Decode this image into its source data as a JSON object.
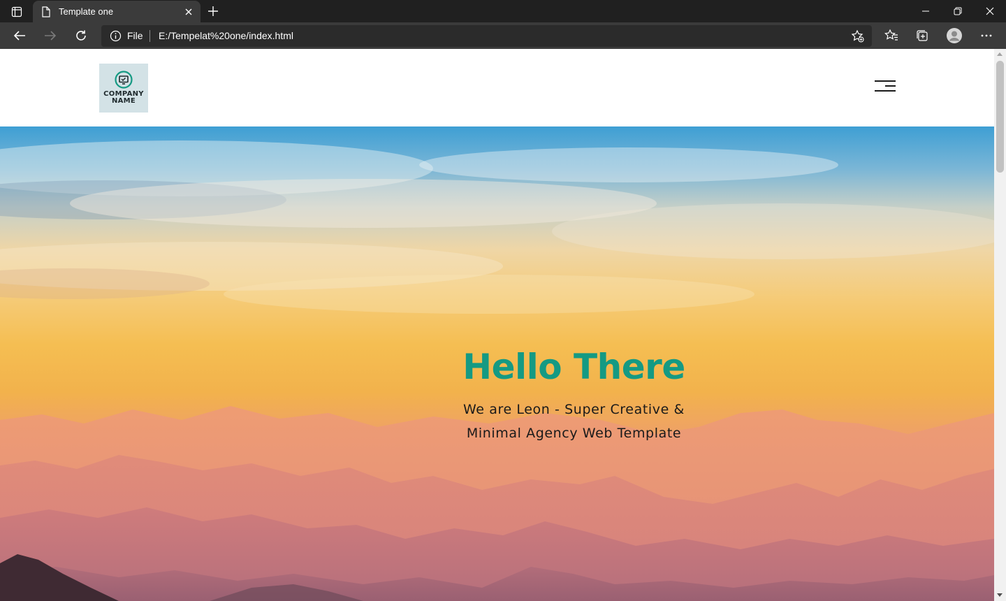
{
  "browser": {
    "tab_title": "Template one",
    "address_scheme_label": "File",
    "url": "E:/Tempelat%20one/index.html",
    "icons": [
      "tab-actions-icon",
      "document-icon",
      "close-icon",
      "plus-icon",
      "minimize-icon",
      "restore-icon",
      "close-window-icon",
      "back-arrow-icon",
      "forward-arrow-icon",
      "refresh-icon",
      "info-icon",
      "add-favorite-icon",
      "favorites-icon",
      "collections-icon",
      "profile-icon",
      "more-icon"
    ]
  },
  "site": {
    "logo": {
      "line1": "COMPANY",
      "line2": "NAME",
      "bg_color": "#d3e2e6",
      "icon": "monitor-check-icon",
      "icon_color": "#159a83"
    },
    "menu_icon": "hamburger-menu-icon",
    "hero": {
      "title": "Hello There",
      "subtitle_line1": "We are Leon - Super Creative &",
      "subtitle_line2": "Minimal Agency Web Template",
      "title_color": "#159a83"
    }
  }
}
